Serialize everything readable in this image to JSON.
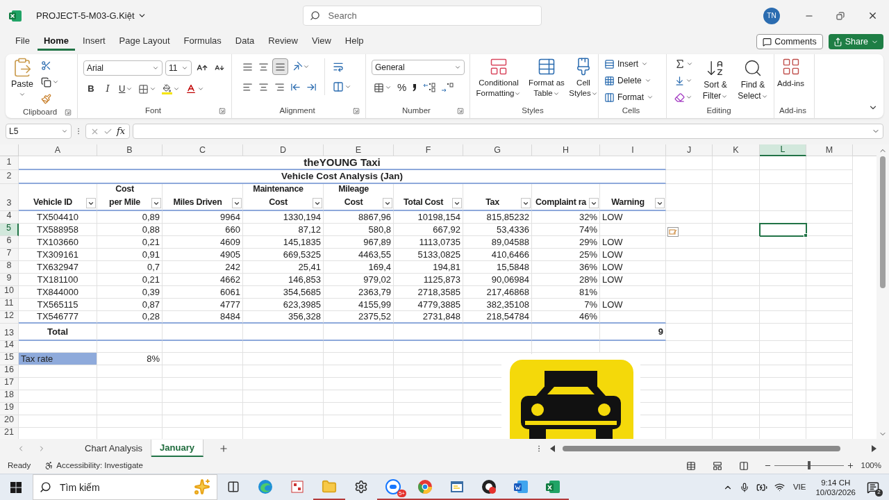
{
  "window": {
    "title": "PROJECT-5-M03-G.Kiệt",
    "search_placeholder": "Search",
    "avatar": "TN"
  },
  "menu": [
    {
      "label": "File",
      "selected": false
    },
    {
      "label": "Home",
      "selected": true
    },
    {
      "label": "Insert",
      "selected": false
    },
    {
      "label": "Page Layout",
      "selected": false
    },
    {
      "label": "Formulas",
      "selected": false
    },
    {
      "label": "Data",
      "selected": false
    },
    {
      "label": "Review",
      "selected": false
    },
    {
      "label": "View",
      "selected": false
    },
    {
      "label": "Help",
      "selected": false
    }
  ],
  "comments_button": "Comments",
  "share_button": "Share",
  "ribbon": {
    "clipboard": {
      "paste": "Paste",
      "title": "Clipboard"
    },
    "font": {
      "name": "Arial",
      "size": "11",
      "bold": "B",
      "italic": "I",
      "underline": "U",
      "title": "Font"
    },
    "alignment": {
      "title": "Alignment"
    },
    "number": {
      "format": "General",
      "percent": "%",
      "title": "Number"
    },
    "styles": {
      "items": [
        "Conditional Formatting",
        "Format as Table",
        "Cell Styles"
      ],
      "title": "Styles"
    },
    "cells": {
      "items": [
        "Insert",
        "Delete",
        "Format"
      ],
      "title": "Cells"
    },
    "editing": {
      "items": [
        "Sort & Filter",
        "Find & Select"
      ],
      "title": "Editing"
    },
    "addins": {
      "button": "Add-ins",
      "title": "Add-ins"
    }
  },
  "formula_bar": {
    "name_box": "L5",
    "fx": "fx"
  },
  "columns": [
    {
      "letter": "A",
      "selected": false
    },
    {
      "letter": "B",
      "selected": false
    },
    {
      "letter": "C",
      "selected": false
    },
    {
      "letter": "D",
      "selected": false
    },
    {
      "letter": "E",
      "selected": false
    },
    {
      "letter": "F",
      "selected": false
    },
    {
      "letter": "G",
      "selected": false
    },
    {
      "letter": "H",
      "selected": false
    },
    {
      "letter": "I",
      "selected": false
    },
    {
      "letter": "J",
      "selected": false
    },
    {
      "letter": "K",
      "selected": false
    },
    {
      "letter": "L",
      "selected": true
    },
    {
      "letter": "M",
      "selected": false
    }
  ],
  "row_numbers": [
    {
      "label": "1",
      "selected": false
    },
    {
      "label": "2",
      "selected": false
    },
    {
      "label": "3",
      "selected": false
    },
    {
      "label": "4",
      "selected": false
    },
    {
      "label": "5",
      "selected": true
    },
    {
      "label": "6",
      "selected": false
    },
    {
      "label": "7",
      "selected": false
    },
    {
      "label": "8",
      "selected": false
    },
    {
      "label": "9",
      "selected": false
    },
    {
      "label": "10",
      "selected": false
    },
    {
      "label": "11",
      "selected": false
    },
    {
      "label": "12",
      "selected": false
    },
    {
      "label": "13",
      "selected": false
    },
    {
      "label": "14",
      "selected": false
    },
    {
      "label": "15",
      "selected": false
    },
    {
      "label": "16",
      "selected": false
    },
    {
      "label": "17",
      "selected": false
    },
    {
      "label": "18",
      "selected": false
    },
    {
      "label": "19",
      "selected": false
    },
    {
      "label": "20",
      "selected": false
    },
    {
      "label": "21",
      "selected": false
    }
  ],
  "sheet": {
    "title": "theYOUNG Taxi",
    "subtitle": "Vehicle Cost Analysis (Jan)",
    "headers": [
      "Vehicle ID",
      "Cost\nper Mile",
      "Miles Driven",
      "Maintenance\nCost",
      "Mileage\nCost",
      "Total Cost",
      "Tax",
      "Complaint ra",
      "Warning"
    ],
    "rows": [
      [
        "TX504410",
        "0,89",
        "9964",
        "1330,194",
        "8867,96",
        "10198,154",
        "815,85232",
        "32%",
        "LOW"
      ],
      [
        "TX588958",
        "0,88",
        "660",
        "87,12",
        "580,8",
        "667,92",
        "53,4336",
        "74%"
      ],
      [
        "TX103660",
        "0,21",
        "4609",
        "145,1835",
        "967,89",
        "1113,0735",
        "89,04588",
        "29%",
        "LOW"
      ],
      [
        "TX309161",
        "0,91",
        "4905",
        "669,5325",
        "4463,55",
        "5133,0825",
        "410,6466",
        "25%",
        "LOW"
      ],
      [
        "TX632947",
        "0,7",
        "242",
        "25,41",
        "169,4",
        "194,81",
        "15,5848",
        "36%",
        "LOW"
      ],
      [
        "TX181100",
        "0,21",
        "4662",
        "146,853",
        "979,02",
        "1125,873",
        "90,06984",
        "28%",
        "LOW"
      ],
      [
        "TX844000",
        "0,39",
        "6061",
        "354,5685",
        "2363,79",
        "2718,3585",
        "217,46868",
        "81%"
      ],
      [
        "TX565115",
        "0,87",
        "4777",
        "623,3985",
        "4155,99",
        "4779,3885",
        "382,35108",
        "7%",
        "LOW"
      ],
      [
        "TX546777",
        "0,28",
        "8484",
        "356,328",
        "2375,52",
        "2731,848",
        "218,54784",
        "46%"
      ]
    ],
    "total": {
      "label": "Total",
      "value": "9"
    },
    "tax_rate": {
      "label": "Tax rate",
      "value": "8%"
    }
  },
  "sheet_tabs": [
    {
      "label": "Chart Analysis",
      "selected": false
    },
    {
      "label": "January",
      "selected": true
    }
  ],
  "status_bar": {
    "ready": "Ready",
    "accessibility": "Accessibility: Investigate",
    "zoom": "100%",
    "level": 0.5
  },
  "taskbar": {
    "search_placeholder": "Tìm kiếm",
    "language": "VIE",
    "time": "9:14 CH",
    "date": "10/03/2026",
    "notifications": "2",
    "zalo_badge": "5+",
    "apps": [
      {
        "kind": "taskview",
        "running": false
      },
      {
        "kind": "edge",
        "running": false
      },
      {
        "kind": "tool",
        "running": false
      },
      {
        "kind": "explorer",
        "running": true
      },
      {
        "kind": "settings",
        "running": false
      },
      {
        "kind": "zalo",
        "running": true
      },
      {
        "kind": "chrome",
        "running": true
      },
      {
        "kind": "python",
        "running": true
      },
      {
        "kind": "obs",
        "running": true
      },
      {
        "kind": "word",
        "running": true
      },
      {
        "kind": "excel",
        "running": true
      }
    ]
  }
}
